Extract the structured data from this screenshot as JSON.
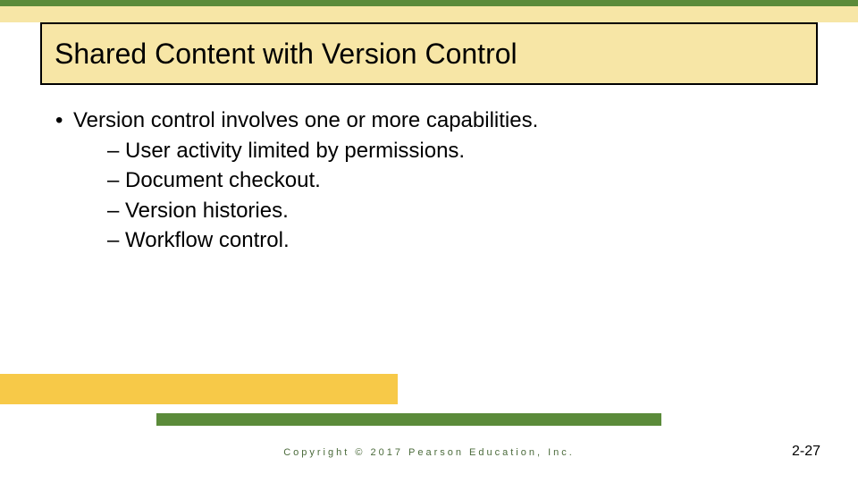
{
  "title": "Shared Content with Version Control",
  "bullet": {
    "main": "Version control involves one or more capabilities.",
    "subs": [
      "User activity limited by permissions.",
      "Document checkout.",
      "Version histories.",
      "Workflow control."
    ]
  },
  "footer": {
    "copyright": "Copyright © 2017 Pearson Education, Inc.",
    "page": "2-27"
  }
}
